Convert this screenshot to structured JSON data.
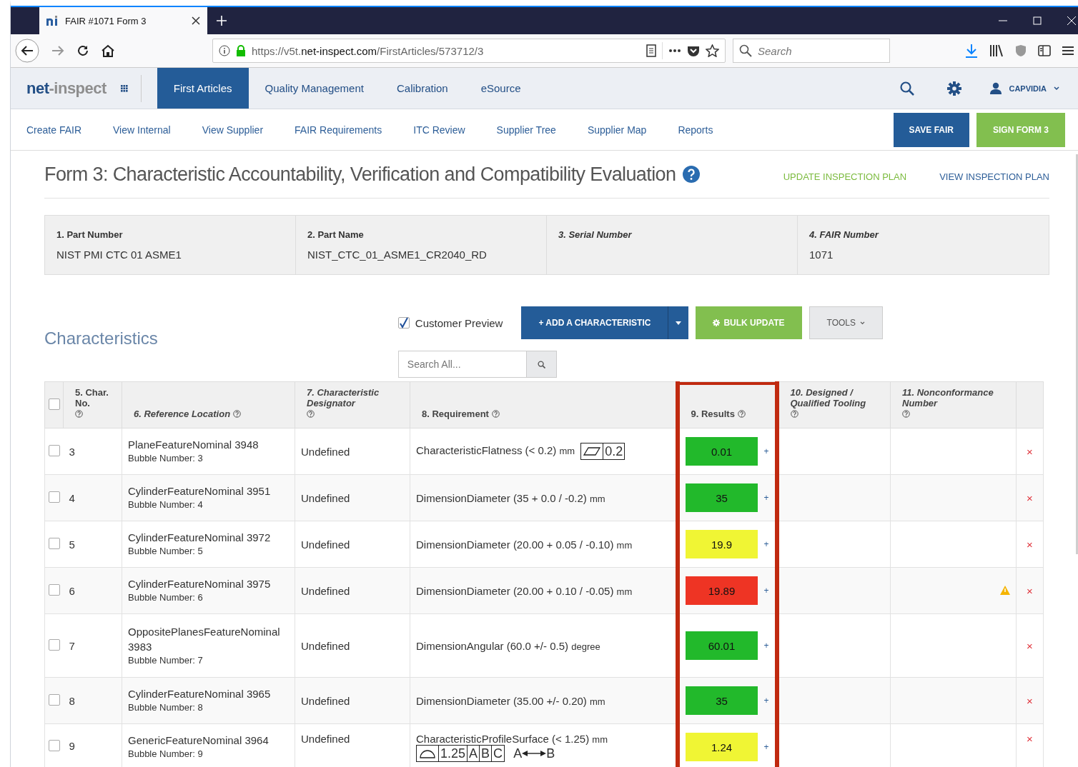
{
  "browser": {
    "tab_title": "FAIR #1071 Form 3",
    "url": {
      "prefix": "https://v5t.",
      "domain": "net-inspect.com",
      "path": "/FirstArticles/573712/3"
    },
    "search_placeholder": "Search"
  },
  "app": {
    "logo": {
      "first": "net",
      "second": "-inspect"
    },
    "nav": [
      {
        "label": "First Articles",
        "selected": true
      },
      {
        "label": "Quality Management",
        "selected": false
      },
      {
        "label": "Calibration",
        "selected": false
      },
      {
        "label": "eSource",
        "selected": false
      }
    ],
    "user": "CAPVIDIA"
  },
  "subnav": [
    "Create FAIR",
    "View Internal",
    "View Supplier",
    "FAIR Requirements",
    "ITC Review",
    "Supplier Tree",
    "Supplier Map",
    "Reports"
  ],
  "actions": [
    {
      "label": "SAVE FAIR",
      "kind": "primary"
    },
    {
      "label": "SIGN FORM 3",
      "kind": "success"
    }
  ],
  "page_title": "Form 3: Characteristic Accountability, Verification and Compatibility Evaluation",
  "title_links": [
    {
      "label": "UPDATE INSPECTION PLAN",
      "kind": "success"
    },
    {
      "label": "VIEW INSPECTION PLAN",
      "kind": "primary"
    }
  ],
  "fields": [
    {
      "label": "1. Part Number",
      "value": "NIST PMI CTC 01 ASME1",
      "italic": false
    },
    {
      "label": "2. Part Name",
      "value": "NIST_CTC_01_ASME1_CR2040_RD",
      "italic": false
    },
    {
      "label": "3. Serial Number",
      "italic": true
    },
    {
      "label": "4. FAIR Number",
      "value": "1071",
      "italic": true
    }
  ],
  "characteristics": {
    "title": "Characteristics",
    "customer_preview": {
      "label": "Customer Preview",
      "checked": true
    },
    "add_button": "+ ADD A CHARACTERISTIC",
    "bulk_button": "BULK UPDATE",
    "tools_button": "TOOLS",
    "search_placeholder": "Search All...",
    "select_all": {
      "checked": false
    },
    "columns": [
      {
        "label": "5. Char. No.",
        "italic": false
      },
      {
        "label": "6. Reference Location",
        "italic": true
      },
      {
        "label": "7. Characteristic Designator",
        "italic": true
      },
      {
        "label": "8. Requirement",
        "italic": false
      },
      {
        "label": "9. Results",
        "italic": false
      },
      {
        "label": "10. Designed / Qualified Tooling",
        "italic": true
      },
      {
        "label": "11. Nonconformance Number",
        "italic": true
      }
    ],
    "rows": [
      {
        "checked": false,
        "no": "3",
        "location": "PlaneFeatureNominal 3948",
        "bubble": "Bubble Number: 3",
        "designator": "Undefined",
        "requirement": "CharacteristicFlatness (< 0.2)",
        "unit": "mm",
        "fcf": [
          {
            "kind": "flatness"
          },
          {
            "kind": "text",
            "text": "0.2"
          }
        ],
        "result": "0.01",
        "color": "#22b92b",
        "plus": "+",
        "warning": false,
        "delete": "×"
      },
      {
        "checked": false,
        "no": "4",
        "location": "CylinderFeatureNominal 3951",
        "bubble": "Bubble Number: 4",
        "designator": "Undefined",
        "requirement": "DimensionDiameter (35 + 0.0 / -0.2)",
        "unit": "mm",
        "result": "35",
        "color": "#22b92b",
        "plus": "+",
        "warning": false,
        "delete": "×"
      },
      {
        "checked": false,
        "no": "5",
        "location": "CylinderFeatureNominal 3972",
        "bubble": "Bubble Number: 5",
        "designator": "Undefined",
        "requirement": "DimensionDiameter (20.00 + 0.05 / -0.10)",
        "unit": "mm",
        "result": "19.9",
        "color": "#f0f534",
        "plus": "+",
        "warning": false,
        "delete": "×"
      },
      {
        "checked": false,
        "no": "6",
        "location": "CylinderFeatureNominal 3975",
        "bubble": "Bubble Number: 6",
        "designator": "Undefined",
        "requirement": "DimensionDiameter (20.00 + 0.10 / -0.05)",
        "unit": "mm",
        "result": "19.89",
        "color": "#ee3424",
        "plus": "+",
        "warning": true,
        "delete": "×"
      },
      {
        "checked": false,
        "no": "7",
        "location": "OppositePlanesFeatureNominal 3983",
        "bubble": "Bubble Number: 7",
        "designator": "Undefined",
        "requirement": "DimensionAngular (60.0 +/- 0.5)",
        "unit": "degree",
        "result": "60.01",
        "color": "#22b92b",
        "plus": "+",
        "warning": false,
        "delete": "×"
      },
      {
        "checked": false,
        "no": "8",
        "location": "CylinderFeatureNominal 3965",
        "bubble": "Bubble Number: 8",
        "designator": "Undefined",
        "requirement": "DimensionDiameter (35.00 +/- 0.20)",
        "unit": "mm",
        "result": "35",
        "color": "#22b92b",
        "plus": "+",
        "warning": false,
        "delete": "×"
      },
      {
        "checked": false,
        "no": "9",
        "location": "GenericFeatureNominal 3964",
        "bubble": "Bubble Number: 9",
        "designator": "Undefined",
        "requirement": "CharacteristicProfileSurface (< 1.25)",
        "unit": "mm",
        "fcf": [
          {
            "kind": "profile"
          },
          {
            "kind": "text",
            "text": "1.25"
          },
          {
            "kind": "text",
            "text": "A"
          },
          {
            "kind": "text",
            "text": "B"
          },
          {
            "kind": "text",
            "text": "C"
          }
        ],
        "between": [
          "A",
          "B"
        ],
        "result": "1.24",
        "color": "#f0f534",
        "plus": "+",
        "warning": false,
        "delete": "×"
      }
    ]
  }
}
